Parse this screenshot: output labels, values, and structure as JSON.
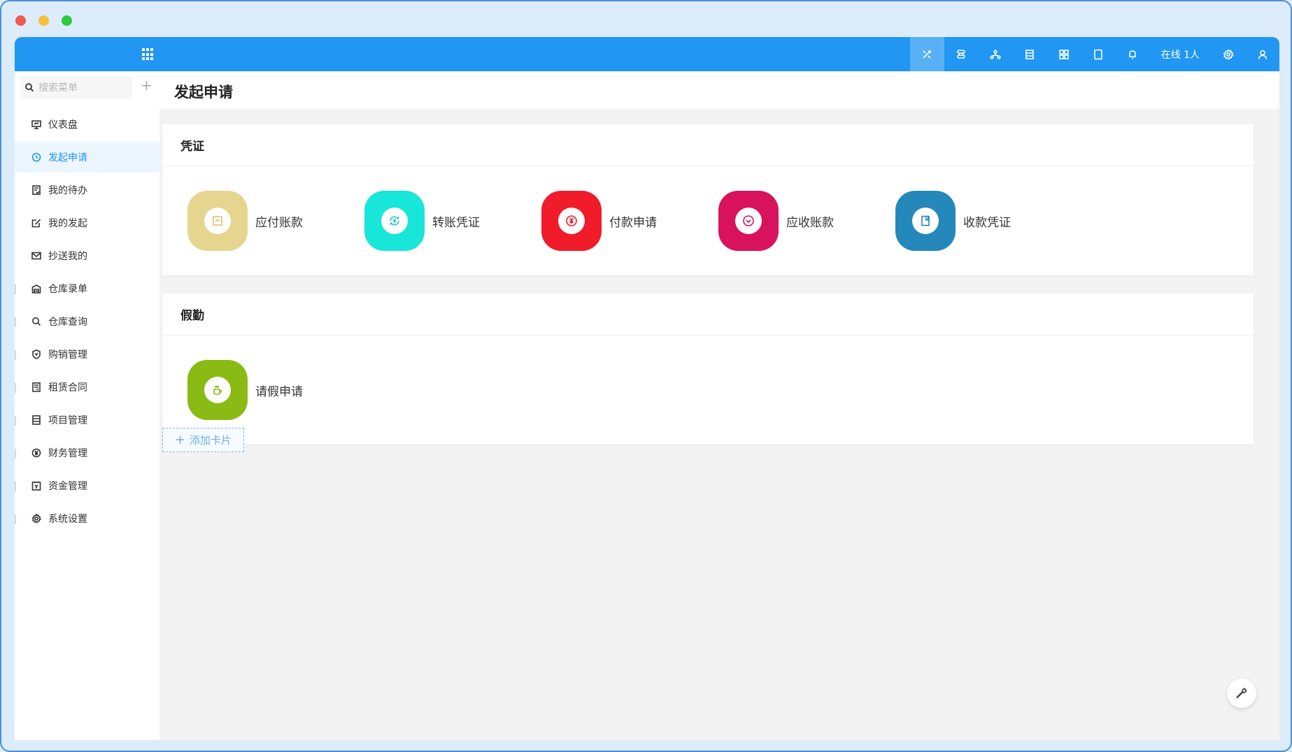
{
  "window": {
    "traffic_lights": [
      "close",
      "minimize",
      "zoom"
    ]
  },
  "topbar": {
    "accent": "#2196f3",
    "online_text": "在线 1人",
    "icons": [
      "tools-icon",
      "flow-icon",
      "org-icon",
      "list-icon",
      "apps-icon",
      "tablet-icon",
      "bell-icon",
      "settings-icon",
      "user-icon"
    ]
  },
  "sidebar": {
    "search_placeholder": "搜索菜单",
    "add_label": "+",
    "items": [
      {
        "label": "仪表盘",
        "icon": "dashboard-icon"
      },
      {
        "label": "发起申请",
        "icon": "clock-icon",
        "active": true
      },
      {
        "label": "我的待办",
        "icon": "todo-icon"
      },
      {
        "label": "我的发起",
        "icon": "edit-icon"
      },
      {
        "label": "抄送我的",
        "icon": "mail-icon"
      },
      {
        "label": "仓库录单",
        "icon": "warehouse-icon"
      },
      {
        "label": "仓库查询",
        "icon": "search-icon"
      },
      {
        "label": "购销管理",
        "icon": "shield-icon"
      },
      {
        "label": "租赁合同",
        "icon": "contract-icon"
      },
      {
        "label": "项目管理",
        "icon": "project-icon"
      },
      {
        "label": "财务管理",
        "icon": "yen-icon"
      },
      {
        "label": "资金管理",
        "icon": "fund-icon"
      },
      {
        "label": "系统设置",
        "icon": "gear-icon"
      }
    ]
  },
  "page": {
    "title": "发起申请"
  },
  "cards": [
    {
      "title": "凭证",
      "apps": [
        {
          "label": "应付账款",
          "color": "#e6d58f",
          "icon": "payable-icon"
        },
        {
          "label": "转账凭证",
          "color": "#17e6d8",
          "icon": "transfer-icon"
        },
        {
          "label": "付款申请",
          "color": "#f01c2a",
          "icon": "payment-icon"
        },
        {
          "label": "应收账款",
          "color": "#d9125e",
          "icon": "receivable-icon"
        },
        {
          "label": "收款凭证",
          "color": "#2588bb",
          "icon": "receipt-icon"
        }
      ]
    },
    {
      "title": "假勤",
      "apps": [
        {
          "label": "请假申请",
          "color": "#8abb14",
          "icon": "coffee-icon"
        }
      ]
    }
  ],
  "add_card": {
    "label": "添加卡片"
  },
  "fab": {
    "icon": "wrench-icon"
  }
}
